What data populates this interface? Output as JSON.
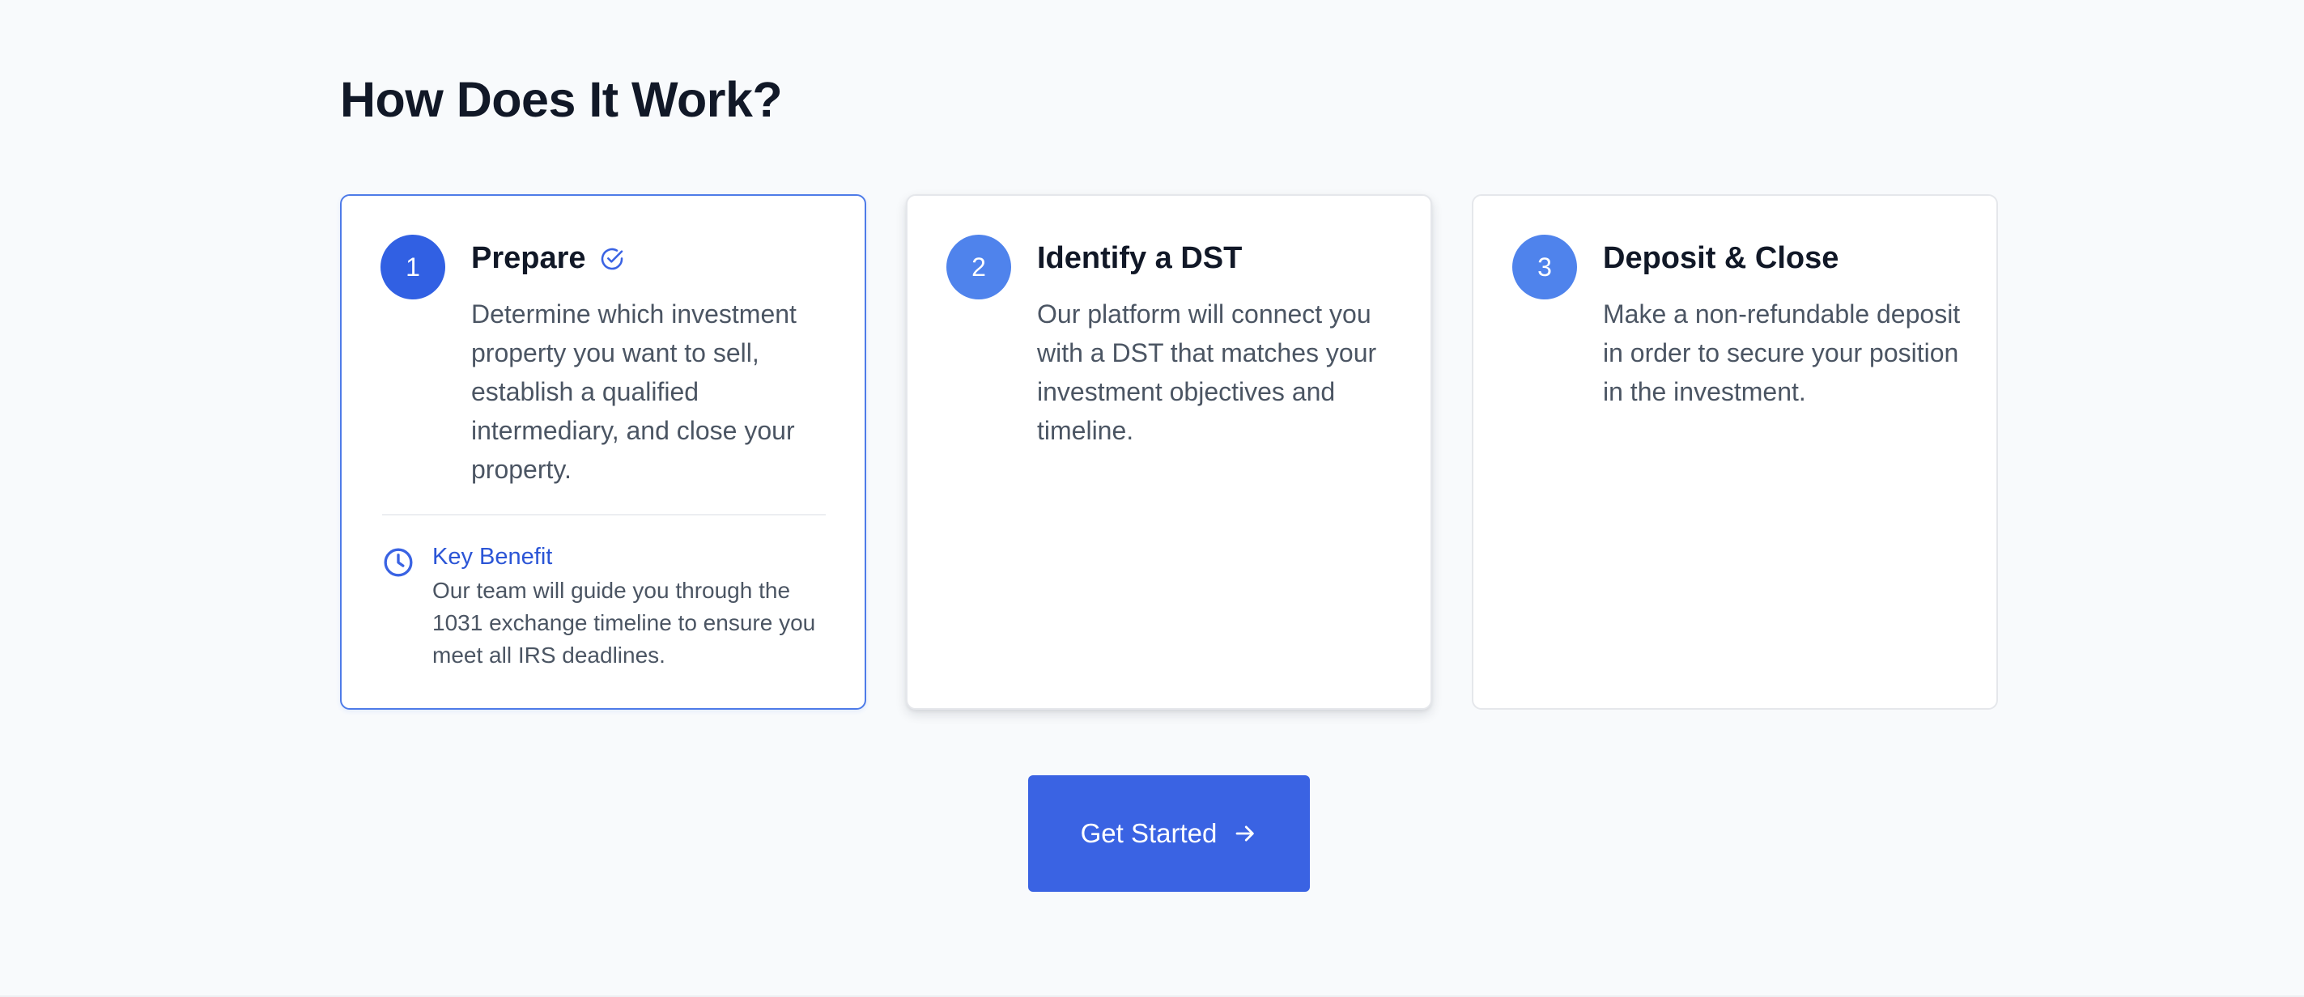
{
  "heading": "How Does It Work?",
  "colors": {
    "accent": "#3a63e3",
    "badge_active": "#3160e3",
    "badge": "#4f83ec",
    "benefit_title": "#2b55d6",
    "active_border": "#4e7be8"
  },
  "steps": [
    {
      "number": "1",
      "title": "Prepare",
      "title_icon": "check-circle-icon",
      "active": true,
      "description": "Determine which investment property you want to sell, establish a qualified intermediary, and close your property.",
      "benefit": {
        "icon": "clock-icon",
        "title": "Key Benefit",
        "text": "Our team will guide you through the 1031 exchange timeline to ensure you meet all IRS deadlines."
      }
    },
    {
      "number": "2",
      "title": "Identify a DST",
      "active": false,
      "description": "Our platform will connect you with a DST that matches your investment objectives and timeline."
    },
    {
      "number": "3",
      "title": "Deposit & Close",
      "active": false,
      "description": "Make a non-refundable deposit in order to secure your position in the investment."
    }
  ],
  "cta": {
    "label": "Get Started",
    "icon": "arrow-right-icon"
  }
}
